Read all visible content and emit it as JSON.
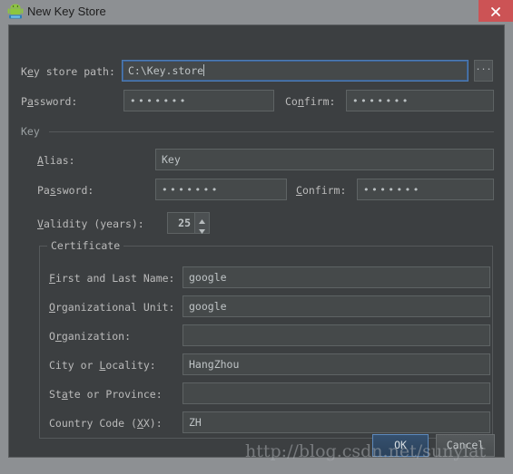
{
  "window": {
    "title": "New Key Store",
    "app_icon": "android-robot-icon",
    "close_label": "×",
    "close_color": "#cc5355",
    "frame_color": "#8d9093",
    "dialog_bg": "#3c3f41",
    "accent_focus": "#4e7cb5"
  },
  "form": {
    "keystore_path": {
      "label_pre": "K",
      "label_mnemonic": "e",
      "label_post": "y store path:",
      "value": "C:\\Key.store",
      "focused": true,
      "browse_label": "..."
    },
    "keystore_password": {
      "label_pre": "P",
      "label_mnemonic": "a",
      "label_post": "ssword:",
      "value": "•••••••"
    },
    "keystore_confirm": {
      "label_pre": "Co",
      "label_mnemonic": "n",
      "label_post": "firm:",
      "value": "•••••••"
    }
  },
  "key_group": {
    "title": "Key",
    "alias": {
      "label_pre": "",
      "label_mnemonic": "A",
      "label_post": "lias:",
      "value": "Key"
    },
    "password": {
      "label_pre": "Pa",
      "label_mnemonic": "s",
      "label_post": "sword:",
      "value": "•••••••"
    },
    "confirm": {
      "label_pre": "",
      "label_mnemonic": "C",
      "label_post": "onfirm:",
      "value": "•••••••"
    },
    "validity": {
      "label_pre": "",
      "label_mnemonic": "V",
      "label_post": "alidity (years):",
      "value": "25"
    }
  },
  "certificate_group": {
    "title": "Certificate",
    "fields": [
      {
        "name": "first-and-last-name",
        "label_pre": "",
        "label_mnemonic": "F",
        "label_post": "irst and Last Name:",
        "value": "google"
      },
      {
        "name": "organizational-unit",
        "label_pre": "",
        "label_mnemonic": "O",
        "label_post": "rganizational Unit:",
        "value": "google"
      },
      {
        "name": "organization",
        "label_pre": "O",
        "label_mnemonic": "r",
        "label_post": "ganization:",
        "value": ""
      },
      {
        "name": "city-or-locality",
        "label_pre": "City or ",
        "label_mnemonic": "L",
        "label_post": "ocality:",
        "value": "HangZhou"
      },
      {
        "name": "state-or-province",
        "label_pre": "St",
        "label_mnemonic": "a",
        "label_post": "te or Province:",
        "value": ""
      },
      {
        "name": "country-code",
        "label_pre": "Country Code (",
        "label_mnemonic": "X",
        "label_post": "X):",
        "value": "ZH"
      }
    ]
  },
  "buttons": {
    "ok": "OK",
    "cancel": "Cancel"
  },
  "watermark": {
    "text": "http://blog.csdn.net/sunylat"
  }
}
